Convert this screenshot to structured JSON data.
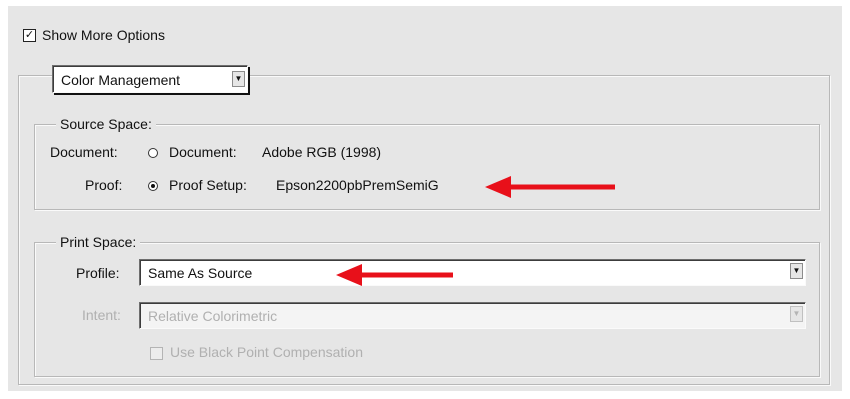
{
  "show_more_options": {
    "label": "Show More Options",
    "checked": true
  },
  "section_select": {
    "value": "Color Management"
  },
  "source_space": {
    "legend": "Source Space:",
    "document_label": "Document:",
    "document_option": {
      "label": "Document:",
      "value": "Adobe RGB (1998)",
      "selected": false
    },
    "proof_label": "Proof:",
    "proof_option": {
      "label": "Proof Setup:",
      "value": "Epson2200pbPremSemiG",
      "selected": true
    }
  },
  "print_space": {
    "legend": "Print Space:",
    "profile_label": "Profile:",
    "profile_value": "Same As Source",
    "intent_label": "Intent:",
    "intent_value": "Relative Colorimetric",
    "bpc": {
      "label": "Use Black Point Compensation",
      "checked": false,
      "disabled": true
    }
  },
  "icons": {
    "checkmark": "✓",
    "dropdown": "▼"
  },
  "colors": {
    "annotation_arrow": "#e8101a",
    "panel_background": "#e6e6e6"
  }
}
